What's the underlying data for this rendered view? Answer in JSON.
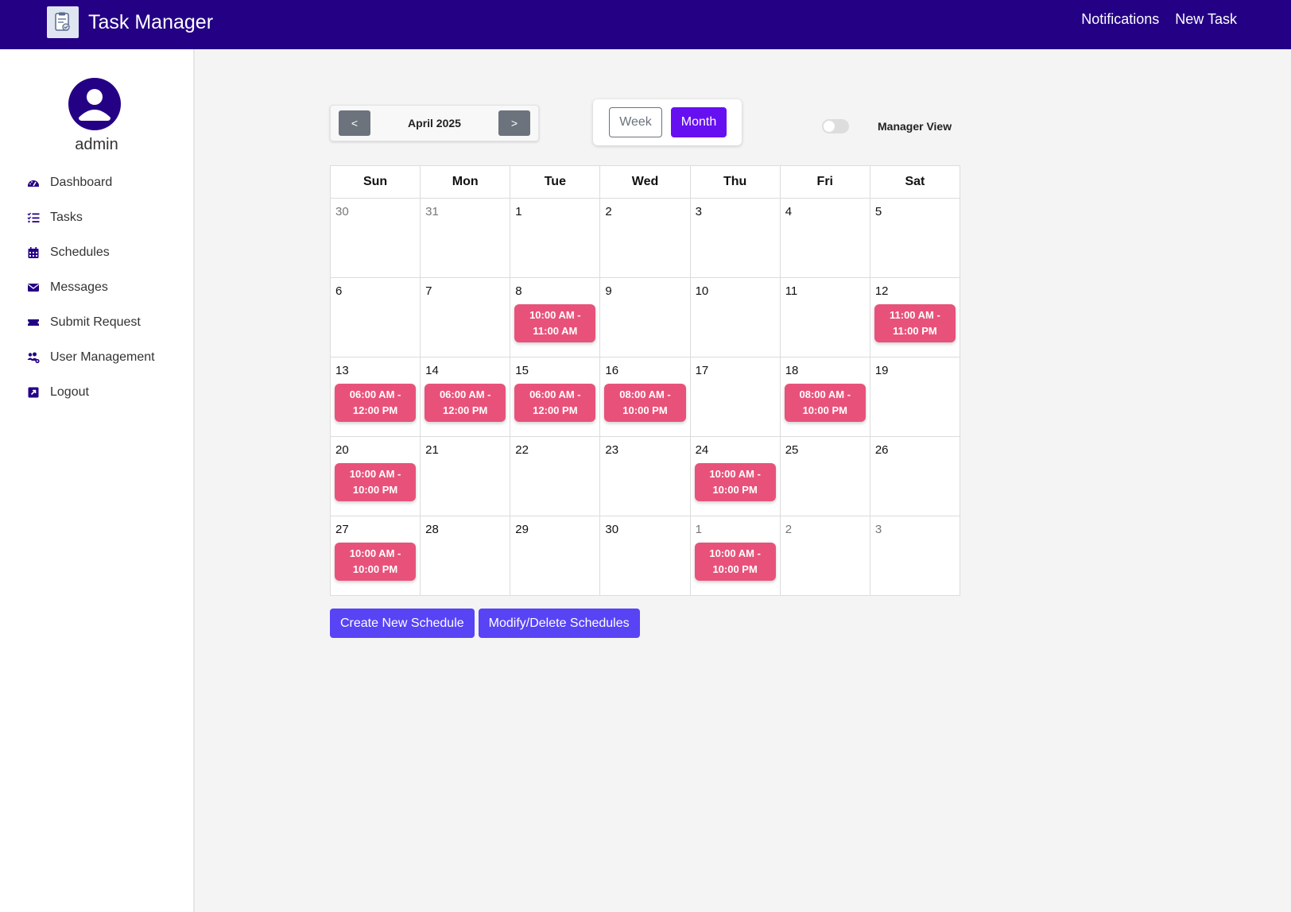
{
  "app": {
    "title": "Task Manager"
  },
  "header": {
    "links": [
      "Notifications",
      "New Task"
    ]
  },
  "user": {
    "name": "admin"
  },
  "sidebar": {
    "items": [
      {
        "label": "Dashboard",
        "icon": "dashboard-icon"
      },
      {
        "label": "Tasks",
        "icon": "tasks-icon"
      },
      {
        "label": "Schedules",
        "icon": "calendar-icon"
      },
      {
        "label": "Messages",
        "icon": "envelope-icon"
      },
      {
        "label": "Submit Request",
        "icon": "ticket-icon"
      },
      {
        "label": "User Management",
        "icon": "users-gear-icon"
      },
      {
        "label": "Logout",
        "icon": "logout-icon"
      }
    ]
  },
  "calendar_nav": {
    "prev": "<",
    "next": ">",
    "month": "April 2025"
  },
  "view": {
    "week": "Week",
    "month": "Month",
    "selected": "Month"
  },
  "manager_view": {
    "label": "Manager View",
    "enabled": false
  },
  "calendar": {
    "weekdays": [
      "Sun",
      "Mon",
      "Tue",
      "Wed",
      "Thu",
      "Fri",
      "Sat"
    ],
    "weeks": [
      [
        {
          "day": "30",
          "other": true
        },
        {
          "day": "31",
          "other": true
        },
        {
          "day": "1"
        },
        {
          "day": "2"
        },
        {
          "day": "3"
        },
        {
          "day": "4"
        },
        {
          "day": "5"
        }
      ],
      [
        {
          "day": "6"
        },
        {
          "day": "7"
        },
        {
          "day": "8",
          "event": [
            "10:00 AM -",
            "11:00 AM"
          ]
        },
        {
          "day": "9"
        },
        {
          "day": "10"
        },
        {
          "day": "11"
        },
        {
          "day": "12",
          "event": [
            "11:00 AM -",
            "11:00 PM"
          ]
        }
      ],
      [
        {
          "day": "13",
          "event": [
            "06:00 AM -",
            "12:00 PM"
          ]
        },
        {
          "day": "14",
          "event": [
            "06:00 AM -",
            "12:00 PM"
          ]
        },
        {
          "day": "15",
          "event": [
            "06:00 AM -",
            "12:00 PM"
          ]
        },
        {
          "day": "16",
          "event": [
            "08:00 AM -",
            "10:00 PM"
          ]
        },
        {
          "day": "17"
        },
        {
          "day": "18",
          "event": [
            "08:00 AM -",
            "10:00 PM"
          ]
        },
        {
          "day": "19"
        }
      ],
      [
        {
          "day": "20",
          "event": [
            "10:00 AM -",
            "10:00 PM"
          ]
        },
        {
          "day": "21"
        },
        {
          "day": "22"
        },
        {
          "day": "23"
        },
        {
          "day": "24",
          "event": [
            "10:00 AM -",
            "10:00 PM"
          ]
        },
        {
          "day": "25"
        },
        {
          "day": "26"
        }
      ],
      [
        {
          "day": "27",
          "event": [
            "10:00 AM -",
            "10:00 PM"
          ]
        },
        {
          "day": "28"
        },
        {
          "day": "29"
        },
        {
          "day": "30"
        },
        {
          "day": "1",
          "other": true,
          "event": [
            "10:00 AM -",
            "10:00 PM"
          ]
        },
        {
          "day": "2",
          "other": true
        },
        {
          "day": "3",
          "other": true
        }
      ]
    ]
  },
  "actions": {
    "create": "Create New Schedule",
    "modify": "Modify/Delete Schedules"
  },
  "colors": {
    "header": "#240085",
    "accent": "#6610f2",
    "event": "#e8527a",
    "action": "#5843f5"
  }
}
